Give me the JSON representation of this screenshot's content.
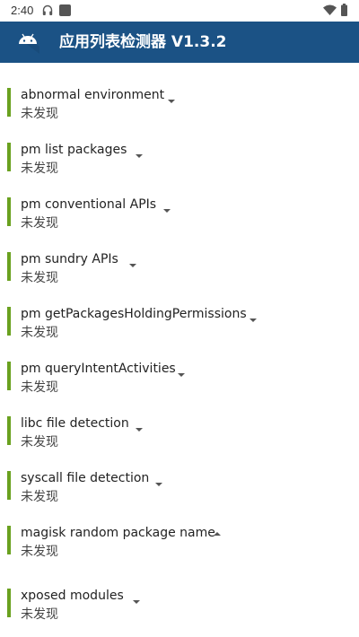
{
  "status_bar": {
    "time": "2:40",
    "icons": [
      "headset-icon",
      "app-notification-icon",
      "wifi-icon",
      "battery-icon"
    ]
  },
  "app_bar": {
    "title": "应用列表检测器 V1.3.2",
    "icon": "android-icon",
    "background": "#1b5285"
  },
  "colors": {
    "accent": "#6aa11f",
    "chevron": "#555555"
  },
  "detections": [
    {
      "title": "abnormal environment",
      "status": "未发现",
      "chevron": "down"
    },
    {
      "title": "pm list packages",
      "status": "未发现",
      "chevron": "down"
    },
    {
      "title": "pm conventional APIs",
      "status": "未发现",
      "chevron": "down"
    },
    {
      "title": "pm sundry APIs",
      "status": "未发现",
      "chevron": "down"
    },
    {
      "title": "pm getPackagesHoldingPermissions",
      "status": "未发现",
      "chevron": "down"
    },
    {
      "title": "pm queryIntentActivities",
      "status": "未发现",
      "chevron": "down"
    },
    {
      "title": "libc file detection",
      "status": "未发现",
      "chevron": "down"
    },
    {
      "title": "syscall file detection",
      "status": "未发现",
      "chevron": "down"
    },
    {
      "title": "magisk random package name",
      "status": "未发现",
      "chevron": "up"
    },
    {
      "title": "xposed modules",
      "status": "未发现",
      "chevron": "down"
    }
  ]
}
